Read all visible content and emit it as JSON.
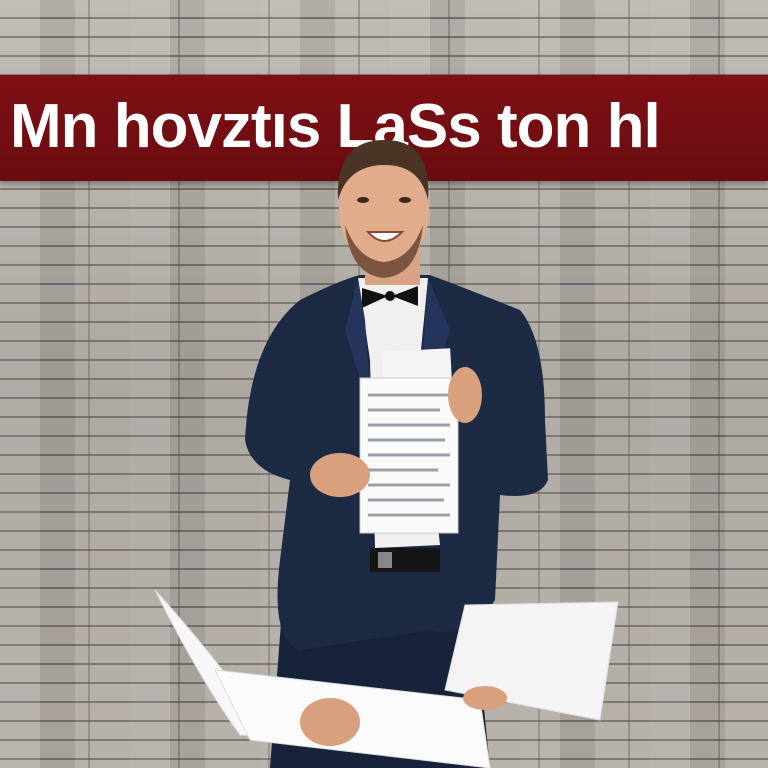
{
  "banner": {
    "text": "Mn hovztıs LąSs ton hl",
    "color": "#750e13"
  },
  "scene": {
    "subject": "smiling man in navy tuxedo holding papers",
    "wall_color": "#aaa59d",
    "suit_color": "#1c2a44"
  }
}
